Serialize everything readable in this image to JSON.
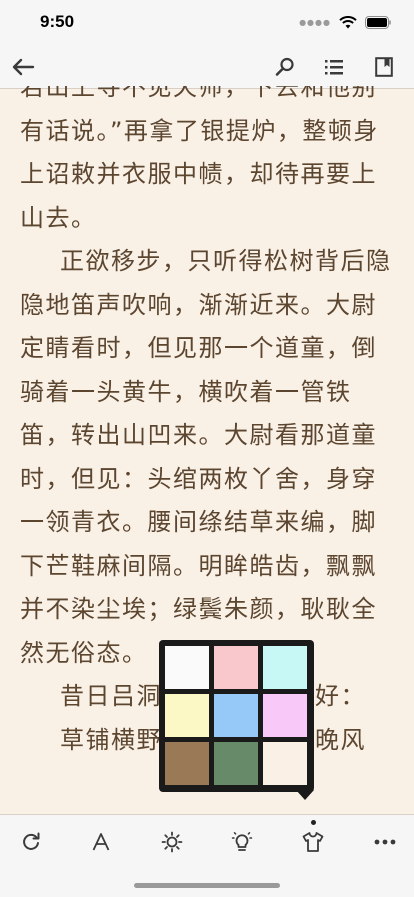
{
  "status_bar": {
    "time": "9:50"
  },
  "nav": {
    "back_icon": "arrow-left-icon",
    "search_icon": "search-icon",
    "toc_icon": "list-icon",
    "bookmark_icon": "bookmark-icon"
  },
  "content": {
    "paragraphs": [
      "若山上寻不见天师，下去和他别有话说。”再拿了银提炉，整顿身上诏敕并衣服中帻，却待再要上山去。",
      "正欲移步，只听得松树背后隐隐地笛声吹响，渐渐近来。大尉定睛看时，但见那一个道童，倒骑着一头黄牛，横吹着一管铁笛，转出山凹来。大尉看那道童时，但见：头绾两枚丫舍，身穿一领青衣。腰间绦结草来编，脚下芒鞋麻间隔。明眸皓齿，飘飘并不染尘埃；绿鬓朱颜，耿耿全然无俗态。",
      "昔日吕洞宾有首诗道得好：",
      "草铺横野六七里，笛弄晚风"
    ]
  },
  "theme_popover": {
    "swatches": [
      "#fafafa",
      "#f8c8cc",
      "#c8f8f6",
      "#fbf8c6",
      "#96c8f8",
      "#f7c8f8",
      "#9a7a56",
      "#678a68",
      "#faf0e6"
    ]
  },
  "toolbar": {
    "items": [
      "refresh-icon",
      "font-icon",
      "brightness-icon",
      "lightbulb-icon",
      "theme-shirt-icon",
      "more-icon"
    ],
    "active": "theme-shirt-icon"
  },
  "colors": {
    "page_background": "#f9f0e6",
    "text": "#5c4630",
    "bar_background": "#f6f6f6"
  }
}
